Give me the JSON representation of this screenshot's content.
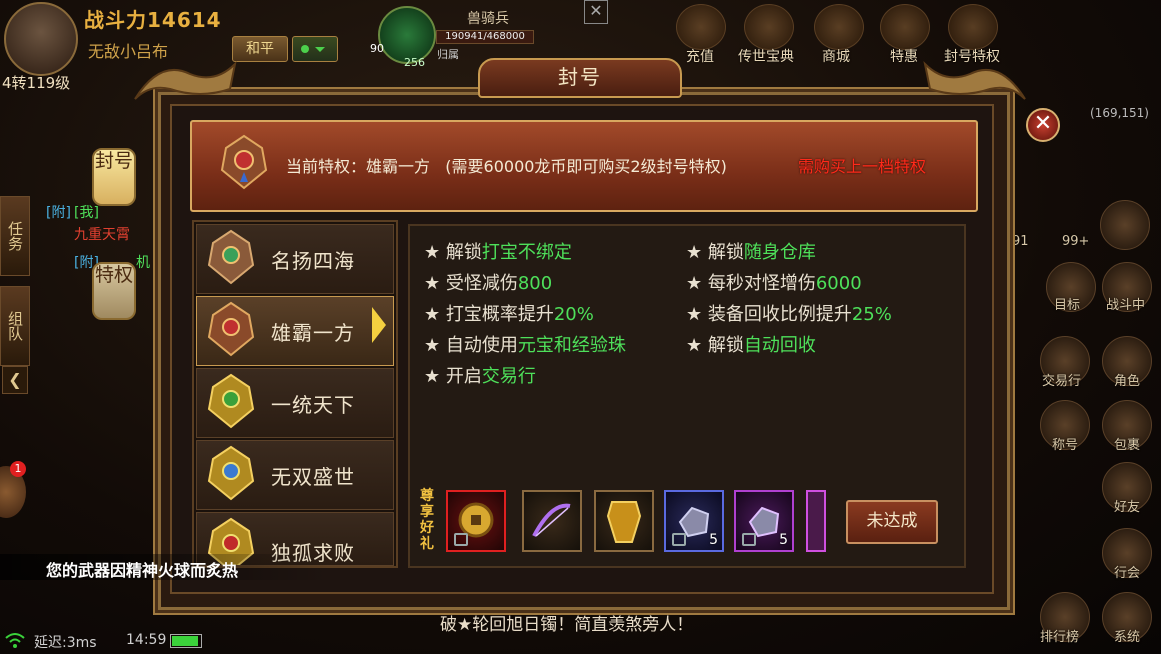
{
  "hud": {
    "power": "战斗力14614",
    "player_name": "无敌小吕布",
    "level": "4转119级",
    "mode": "和平",
    "pet_name": "兽骑兵",
    "pet_hp": "190941/468000",
    "pet_level": "90",
    "pet_sub": "256",
    "pet_tag": "归属",
    "top_menu": [
      "充值",
      "传世宝典",
      "商城",
      "特惠",
      "封号特权"
    ],
    "coords": "(169,151)",
    "right_menu": [
      "目标",
      "战斗中",
      "交易行",
      "角色",
      "称号",
      "包裹",
      "好友",
      "行会",
      "排行榜",
      "系统"
    ],
    "small_counts": [
      "91",
      "99+"
    ]
  },
  "left_tabs": [
    "任务",
    "组队"
  ],
  "chat": [
    {
      "tag": "[附]",
      "text": "[我]"
    },
    {
      "tag": "",
      "text": "九重天霄"
    },
    {
      "tag": "[附]",
      "text": "机"
    }
  ],
  "badge_count": "1",
  "left_hangers": [
    "封号",
    "特权"
  ],
  "panel": {
    "title": "封号",
    "current_label": "当前特权：雄霸一方",
    "current_note": "(需要60000龙币即可购买2级封号特权)",
    "buy_link": "需购买上一档特权",
    "tiers": [
      "名扬四海",
      "雄霸一方",
      "一统天下",
      "无双盛世",
      "独孤求败"
    ],
    "selected_tier": 1,
    "perks_left": [
      {
        "pre": "★ 解锁",
        "hl": "打宝不绑定"
      },
      {
        "pre": "★ 受怪减伤",
        "hl": "800"
      },
      {
        "pre": "★ 打宝概率提升",
        "hl": "20%"
      },
      {
        "pre": "★ 自动使用",
        "hl": "元宝和经验珠"
      },
      {
        "pre": "★ 开启",
        "hl": "交易行"
      }
    ],
    "perks_right": [
      {
        "pre": "★ 解锁",
        "hl": "随身仓库"
      },
      {
        "pre": "★ 每秒对怪增伤",
        "hl": "6000"
      },
      {
        "pre": "★ 装备回收比例提升",
        "hl": "25%"
      },
      {
        "pre": "★ 解锁",
        "hl": "自动回收"
      }
    ],
    "reward_label": "尊享好礼",
    "reward_counts": [
      "",
      "",
      "",
      "5",
      "5"
    ],
    "button": "未达成"
  },
  "weapon_msg": "您的武器因精神火球而炙热",
  "ticker": "破★轮回旭日镯！简直羡煞旁人！",
  "status": {
    "latency": "延迟:3ms",
    "time": "14:59"
  }
}
